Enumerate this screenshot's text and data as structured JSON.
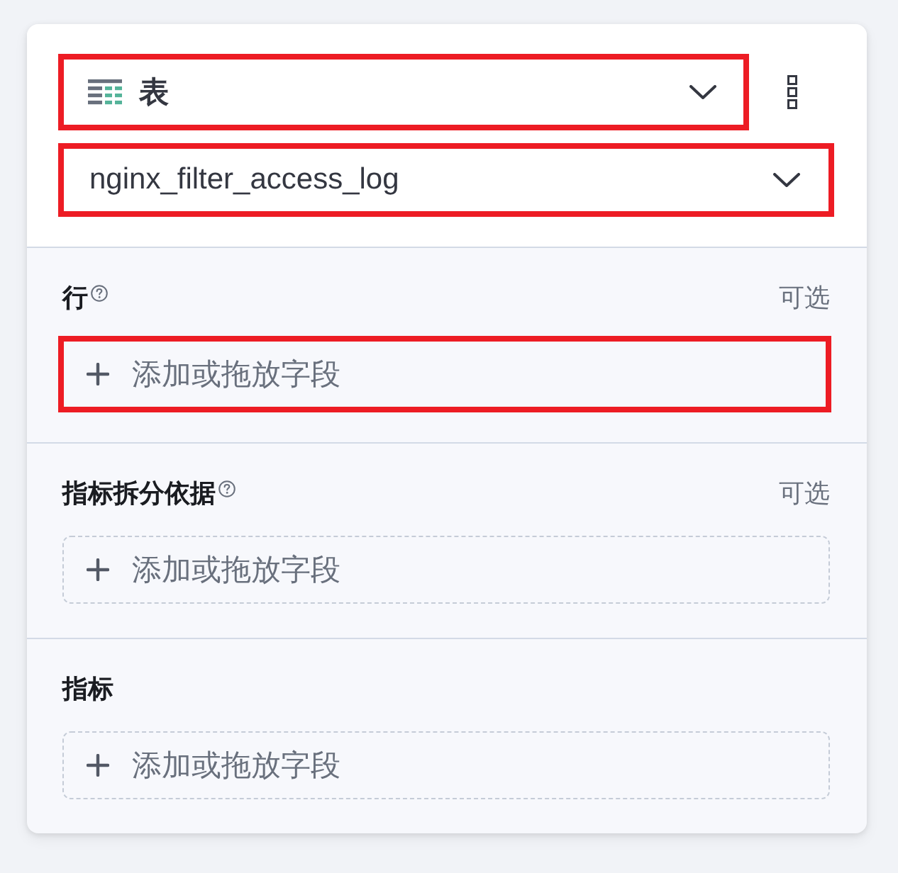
{
  "chart_type_select": {
    "value": "表",
    "highlighted": true
  },
  "data_view_select": {
    "value": "nginx_filter_access_log",
    "highlighted": true
  },
  "sections": [
    {
      "label": "行",
      "help": true,
      "hint": "可选",
      "add_button": {
        "label": "添加或拖放字段",
        "highlighted": true
      }
    },
    {
      "label": "指标拆分依据",
      "help": true,
      "hint": "可选",
      "add_button": {
        "label": "添加或拖放字段",
        "highlighted": false
      }
    },
    {
      "label": "指标",
      "help": false,
      "add_button": {
        "label": "添加或拖放字段",
        "highlighted": false
      }
    }
  ]
}
